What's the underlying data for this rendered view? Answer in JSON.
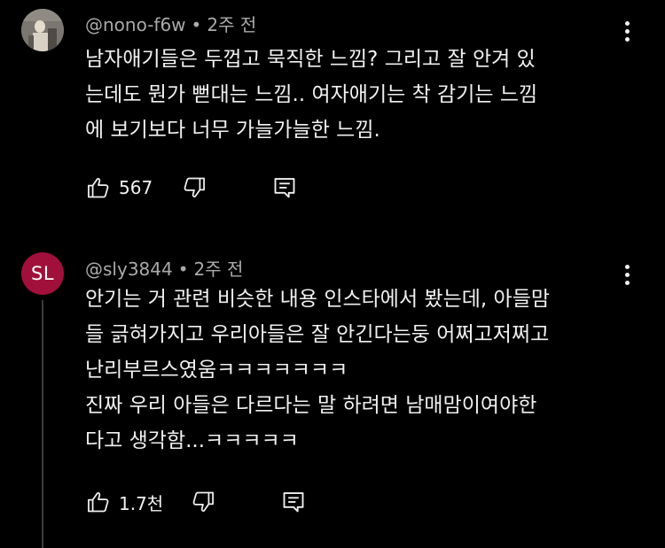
{
  "colors": {
    "background": "#000000",
    "text": "#f1f1f1",
    "meta": "#aaaaaa",
    "avatar_sl": "#a0103a",
    "thread_line": "#3b3b3b"
  },
  "comments": [
    {
      "author": "@nono-f6w",
      "separator": "•",
      "time": "2주 전",
      "avatar_type": "photo",
      "lines": [
        "남자애기들은 두껍고 묵직한 느낌? 그리고 잘 안겨 있",
        "는데도 뭔가 뻗대는 느낌.. 여자애기는 착 감기는 느낌",
        "에 보기보다 너무 가늘가늘한 느낌."
      ],
      "likes": "567",
      "icons": [
        "thumbs-up-icon",
        "thumbs-down-icon",
        "reply-icon",
        "more-vert-icon"
      ]
    },
    {
      "author": "@sly3844",
      "separator": "•",
      "time": "2주 전",
      "avatar_initials": "SL",
      "lines": [
        "안기는 거 관련 비슷한 내용 인스타에서 봤는데, 아들맘",
        "들 긁혀가지고 우리아들은 잘 안긴다는둥 어쩌고저쩌고",
        "난리부르스였움ㅋㅋㅋㅋㅋㅋㅋ",
        "진짜 우리 아들은 다르다는 말 하려면 남매맘이여야한",
        "다고 생각함...ㅋㅋㅋㅋㅋ"
      ],
      "likes": "1.7천",
      "icons": [
        "thumbs-up-icon",
        "thumbs-down-icon",
        "reply-icon",
        "more-vert-icon"
      ]
    }
  ]
}
